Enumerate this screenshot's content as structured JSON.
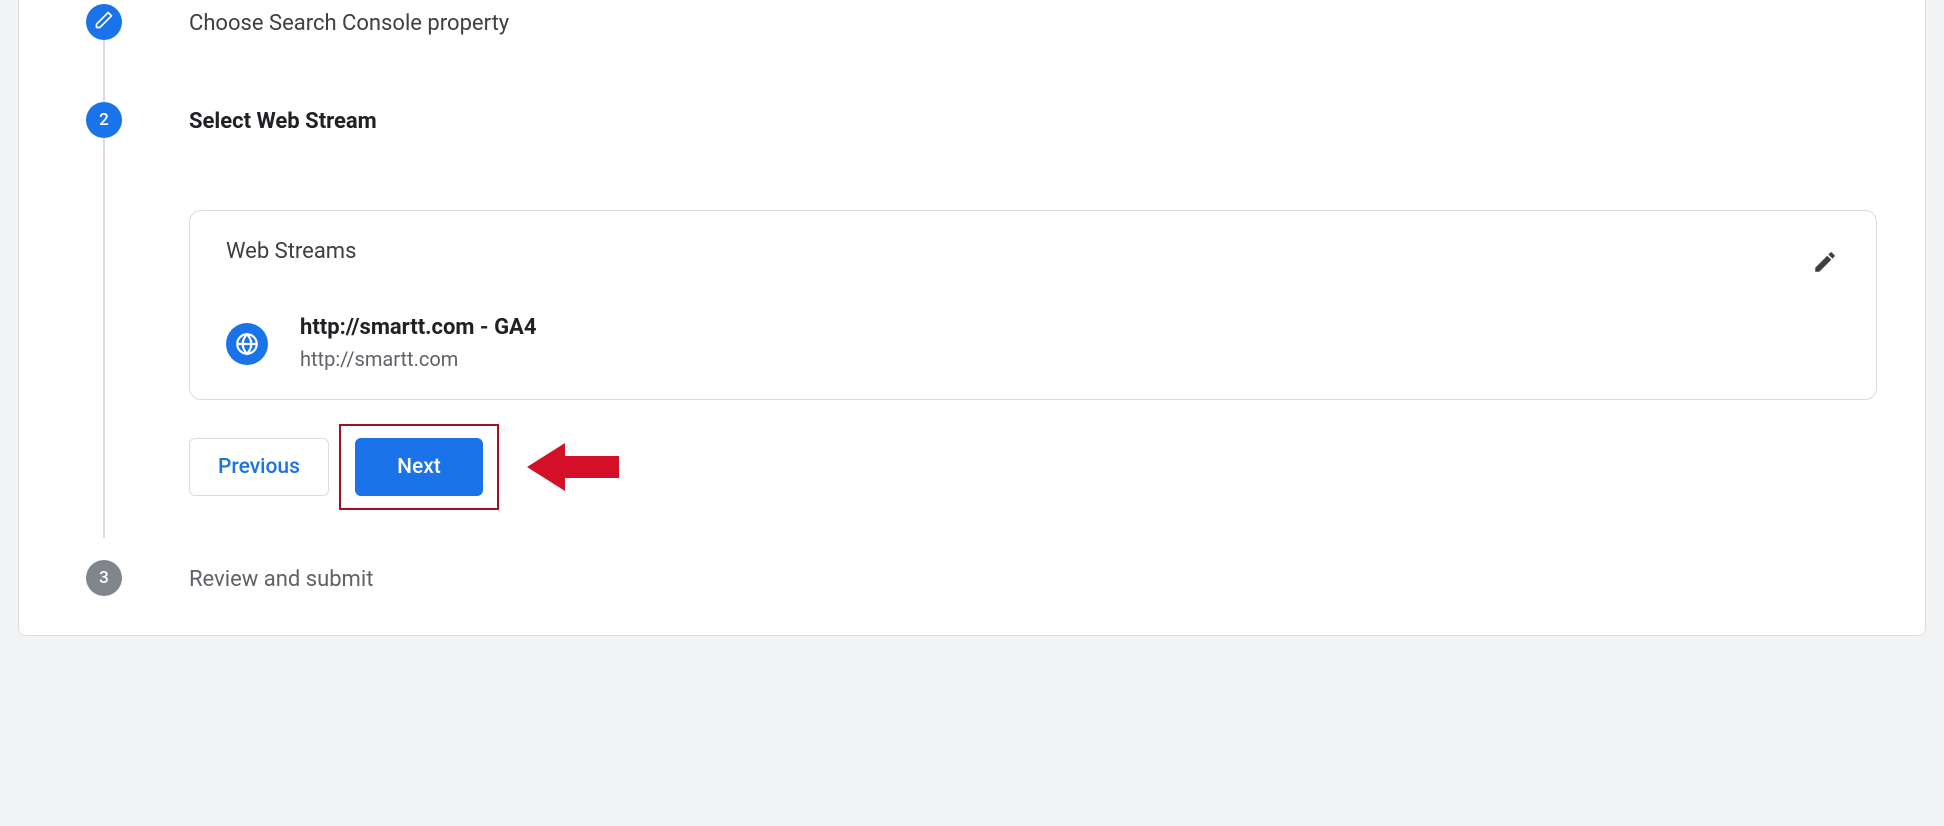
{
  "colors": {
    "primary": "#1a73e8",
    "annotation": "#d31027"
  },
  "steps": {
    "s1": {
      "title": "Choose Search Console property",
      "state": "done"
    },
    "s2": {
      "title": "Select Web Stream",
      "number": "2",
      "state": "active",
      "card_title": "Web Streams",
      "stream": {
        "name": "http://smartt.com - GA4",
        "url": "http://smartt.com"
      },
      "buttons": {
        "previous": "Previous",
        "next": "Next"
      }
    },
    "s3": {
      "title": "Review and submit",
      "number": "3",
      "state": "pending"
    }
  }
}
